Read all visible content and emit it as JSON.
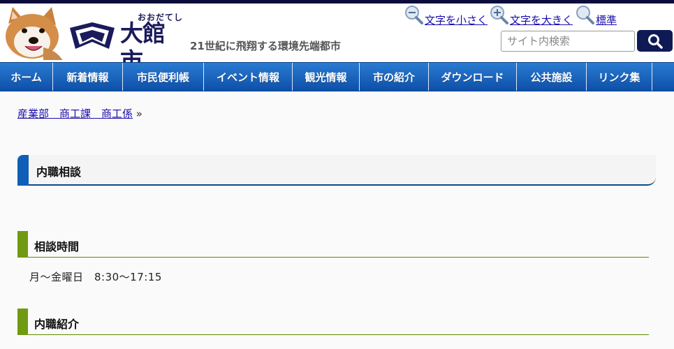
{
  "header": {
    "logo_kana": "おおだてし",
    "logo_name": "大館市",
    "tagline": "21世紀に飛翔する環境先端都市"
  },
  "font_controls": {
    "smaller": "文字を小さく",
    "larger": "文字を大きく",
    "standard": "標準"
  },
  "search": {
    "placeholder": "サイト内検索"
  },
  "nav": {
    "items": [
      "ホーム",
      "新着情報",
      "市民便利帳",
      "イベント情報",
      "観光情報",
      "市の紹介",
      "ダウンロード",
      "公共施設",
      "リンク集"
    ]
  },
  "breadcrumb": {
    "link": "産業部　商工課　商工係",
    "separator": "»"
  },
  "page": {
    "title": "内職相談"
  },
  "sections": [
    {
      "heading": "相談時間",
      "text": "月～金曜日　8:30～17:15"
    },
    {
      "heading": "内職紹介"
    }
  ],
  "colors": {
    "nav": "#1a66c4",
    "accent_blue": "#0e5fb5",
    "accent_green": "#6f9a12",
    "search_button": "#0f1a55"
  }
}
